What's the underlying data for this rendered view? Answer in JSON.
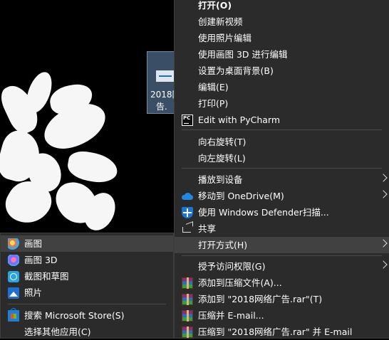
{
  "desktop": {
    "file": {
      "name_line1": "2018网",
      "name_line2": "告.",
      "selected": true
    }
  },
  "context_menu": {
    "items": [
      {
        "label": "打开(O)",
        "bold": true
      },
      {
        "label": "创建新视频"
      },
      {
        "label": "使用照片编辑"
      },
      {
        "label": "使用画图 3D 进行编辑"
      },
      {
        "label": "设置为桌面背景(B)"
      },
      {
        "label": "编辑(E)"
      },
      {
        "label": "打印(P)"
      },
      {
        "label": "Edit with PyCharm",
        "icon": "pycharm-icon"
      },
      {
        "label": "向右旋转(T)"
      },
      {
        "label": "向左旋转(L)"
      },
      {
        "label": "播放到设备",
        "submenu": true
      },
      {
        "label": "移动到 OneDrive(M)",
        "icon": "onedrive-icon",
        "submenu": true
      },
      {
        "label": "使用 Windows Defender扫描...",
        "icon": "windows-defender-icon"
      },
      {
        "label": "共享",
        "icon": "share-icon"
      },
      {
        "label": "打开方式(H)",
        "submenu": true,
        "highlighted": true
      },
      {
        "label": "授予访问权限(G)",
        "submenu": true
      },
      {
        "label": "添加到压缩文件(A)...",
        "icon": "winrar-icon"
      },
      {
        "label": "添加到 \"2018网络广告.rar\"(T)",
        "icon": "winrar-icon"
      },
      {
        "label": "压缩并 E-mail...",
        "icon": "winrar-icon"
      },
      {
        "label": "压缩到 \"2018网络广告.rar\" 并 E-mail",
        "icon": "winrar-icon"
      }
    ]
  },
  "open_with_menu": {
    "items": [
      {
        "label": "画图",
        "icon": "paint-icon",
        "highlighted": true
      },
      {
        "label": "画图 3D",
        "icon": "paint-3d-icon"
      },
      {
        "label": "截图和草图",
        "icon": "snip-and-sketch-icon"
      },
      {
        "label": "照片",
        "icon": "photos-icon"
      },
      {
        "label": "搜索 Microsoft Store(S)",
        "icon": "microsoft-store-icon"
      },
      {
        "label": "选择其他应用(C)"
      }
    ]
  },
  "colors": {
    "menu_bg": "#2b2b2b",
    "highlight": "#414141",
    "separator": "#4a4a4a",
    "text": "#ffffff"
  }
}
